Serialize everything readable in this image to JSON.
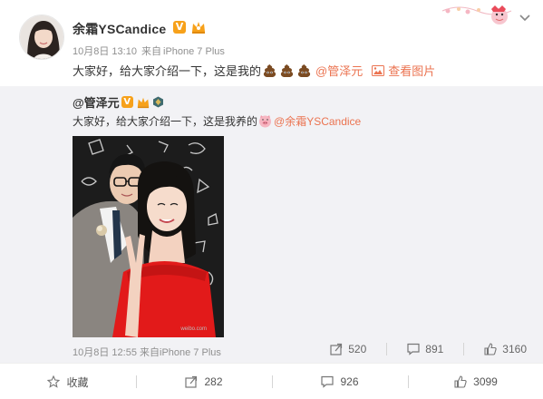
{
  "post": {
    "author": "余霜YSCandice",
    "vip_mark": "V",
    "date": "10月8日 13:10",
    "source_prefix": "来自",
    "source": "iPhone 7 Plus",
    "text": "大家好，给大家介绍一下，这是我的",
    "emoji": "poop-emoji",
    "mention": "@管泽元",
    "view_photo": "查看图片"
  },
  "repost": {
    "author": "@管泽元",
    "vip_mark": "V",
    "text": "大家好，给大家介绍一下，这是我养的",
    "emoji": "pig-emoji",
    "mention": "@余霜YSCandice",
    "date": "10月8日 12:55",
    "source_prefix": "来自",
    "source": "iPhone 7 Plus",
    "repost_count": "520",
    "comment_count": "891",
    "like_count": "3160"
  },
  "actions": {
    "favorite": "收藏",
    "repost": "282",
    "comment": "926",
    "like": "3099"
  },
  "colors": {
    "link": "#eb7350",
    "vip": "#f7a11a",
    "repost_bg": "#f2f2f5"
  }
}
